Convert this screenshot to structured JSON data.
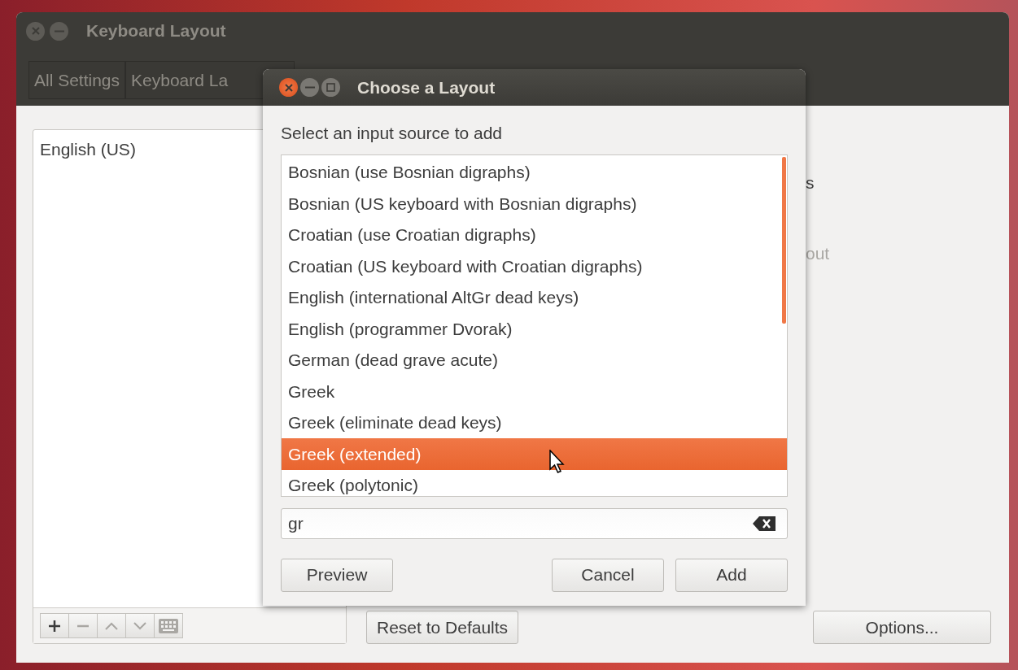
{
  "window": {
    "title": "Keyboard Layout",
    "breadcrumbs": [
      "All Settings",
      "Keyboard La"
    ]
  },
  "input_sources": [
    {
      "label": "English (US)"
    }
  ],
  "right_panel_fragments": [
    {
      "text": "s",
      "kind": "heading"
    },
    {
      "text": "out",
      "kind": "dimmed"
    }
  ],
  "reset_button": "Reset to Defaults",
  "options_button": "Options...",
  "dialog": {
    "title": "Choose a Layout",
    "prompt": "Select an input source to add",
    "layouts": [
      {
        "label": "Bosnian (use Bosnian digraphs)",
        "selected": false
      },
      {
        "label": "Bosnian (US keyboard with Bosnian digraphs)",
        "selected": false
      },
      {
        "label": "Croatian (use Croatian digraphs)",
        "selected": false
      },
      {
        "label": "Croatian (US keyboard with Croatian digraphs)",
        "selected": false
      },
      {
        "label": "English (international AltGr dead keys)",
        "selected": false
      },
      {
        "label": "English (programmer Dvorak)",
        "selected": false
      },
      {
        "label": "German (dead grave acute)",
        "selected": false
      },
      {
        "label": "Greek",
        "selected": false
      },
      {
        "label": "Greek (eliminate dead keys)",
        "selected": false
      },
      {
        "label": "Greek (extended)",
        "selected": true
      },
      {
        "label": "Greek (polytonic)",
        "selected": false
      }
    ],
    "search": {
      "value": "gr"
    },
    "buttons": [
      {
        "label": "Preview",
        "kind": "left"
      },
      {
        "label": "Cancel",
        "kind": "right"
      },
      {
        "label": "Add",
        "kind": "right"
      }
    ]
  }
}
